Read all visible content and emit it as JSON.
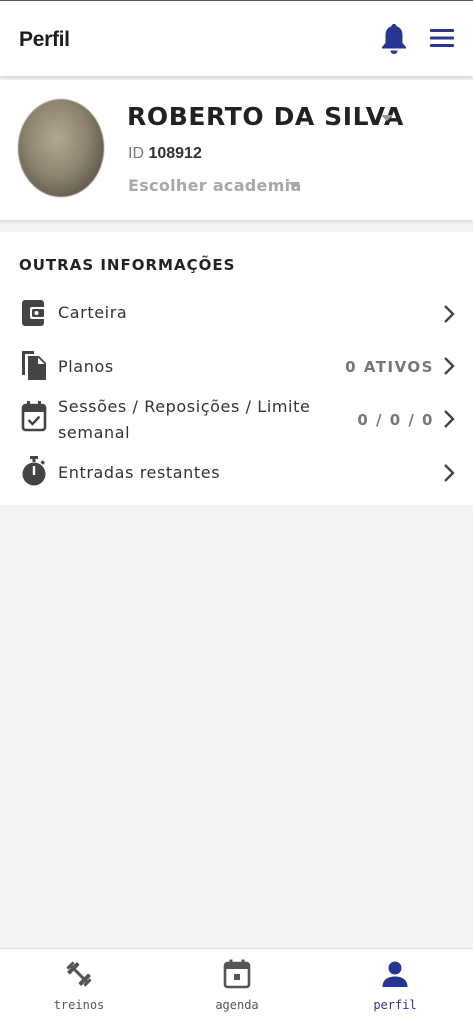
{
  "header": {
    "title": "Perfil",
    "icons": [
      "bell-icon",
      "hamburger-menu-icon"
    ],
    "accent_color": "#283593"
  },
  "profile": {
    "name": "ROBERTO DA SILVA",
    "id_label": "ID",
    "id_value": "108912",
    "gym_select": "Escolher academia"
  },
  "other_info": {
    "heading": "OUTRAS INFORMAÇÕES",
    "items": [
      {
        "label": "Carteira",
        "value": "",
        "icon": "wallet-icon"
      },
      {
        "label": "Planos",
        "value": "0 ATIVOS",
        "icon": "documents-icon"
      },
      {
        "label_line1": "Sessões / Reposições / Limite",
        "label_line2": "semanal",
        "value": "0 / 0 / 0",
        "icon": "calendar-check-icon"
      },
      {
        "label": "Entradas restantes",
        "value": "",
        "icon": "stopwatch-icon"
      }
    ]
  },
  "bottom_nav": {
    "items": [
      {
        "label": "treinos",
        "icon": "dumbbell-icon",
        "active": false
      },
      {
        "label": "agenda",
        "icon": "calendar-icon",
        "active": false
      },
      {
        "label": "perfil",
        "icon": "person-icon",
        "active": true
      }
    ]
  }
}
